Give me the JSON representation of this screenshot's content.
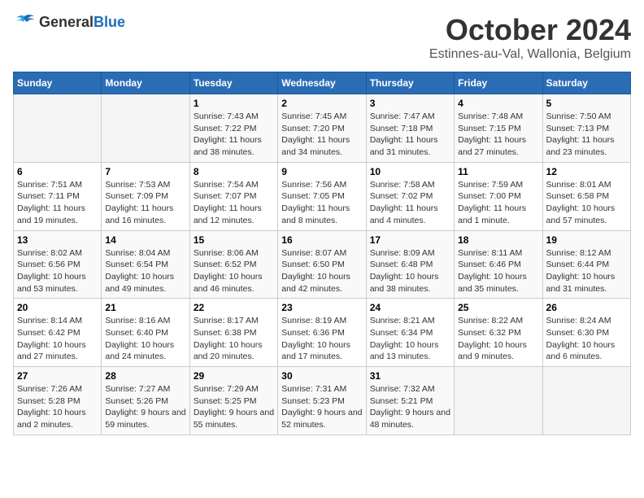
{
  "header": {
    "logo_general": "General",
    "logo_blue": "Blue",
    "month": "October 2024",
    "location": "Estinnes-au-Val, Wallonia, Belgium"
  },
  "weekdays": [
    "Sunday",
    "Monday",
    "Tuesday",
    "Wednesday",
    "Thursday",
    "Friday",
    "Saturday"
  ],
  "weeks": [
    [
      {
        "day": "",
        "sunrise": "",
        "sunset": "",
        "daylight": ""
      },
      {
        "day": "",
        "sunrise": "",
        "sunset": "",
        "daylight": ""
      },
      {
        "day": "1",
        "sunrise": "Sunrise: 7:43 AM",
        "sunset": "Sunset: 7:22 PM",
        "daylight": "Daylight: 11 hours and 38 minutes."
      },
      {
        "day": "2",
        "sunrise": "Sunrise: 7:45 AM",
        "sunset": "Sunset: 7:20 PM",
        "daylight": "Daylight: 11 hours and 34 minutes."
      },
      {
        "day": "3",
        "sunrise": "Sunrise: 7:47 AM",
        "sunset": "Sunset: 7:18 PM",
        "daylight": "Daylight: 11 hours and 31 minutes."
      },
      {
        "day": "4",
        "sunrise": "Sunrise: 7:48 AM",
        "sunset": "Sunset: 7:15 PM",
        "daylight": "Daylight: 11 hours and 27 minutes."
      },
      {
        "day": "5",
        "sunrise": "Sunrise: 7:50 AM",
        "sunset": "Sunset: 7:13 PM",
        "daylight": "Daylight: 11 hours and 23 minutes."
      }
    ],
    [
      {
        "day": "6",
        "sunrise": "Sunrise: 7:51 AM",
        "sunset": "Sunset: 7:11 PM",
        "daylight": "Daylight: 11 hours and 19 minutes."
      },
      {
        "day": "7",
        "sunrise": "Sunrise: 7:53 AM",
        "sunset": "Sunset: 7:09 PM",
        "daylight": "Daylight: 11 hours and 16 minutes."
      },
      {
        "day": "8",
        "sunrise": "Sunrise: 7:54 AM",
        "sunset": "Sunset: 7:07 PM",
        "daylight": "Daylight: 11 hours and 12 minutes."
      },
      {
        "day": "9",
        "sunrise": "Sunrise: 7:56 AM",
        "sunset": "Sunset: 7:05 PM",
        "daylight": "Daylight: 11 hours and 8 minutes."
      },
      {
        "day": "10",
        "sunrise": "Sunrise: 7:58 AM",
        "sunset": "Sunset: 7:02 PM",
        "daylight": "Daylight: 11 hours and 4 minutes."
      },
      {
        "day": "11",
        "sunrise": "Sunrise: 7:59 AM",
        "sunset": "Sunset: 7:00 PM",
        "daylight": "Daylight: 11 hours and 1 minute."
      },
      {
        "day": "12",
        "sunrise": "Sunrise: 8:01 AM",
        "sunset": "Sunset: 6:58 PM",
        "daylight": "Daylight: 10 hours and 57 minutes."
      }
    ],
    [
      {
        "day": "13",
        "sunrise": "Sunrise: 8:02 AM",
        "sunset": "Sunset: 6:56 PM",
        "daylight": "Daylight: 10 hours and 53 minutes."
      },
      {
        "day": "14",
        "sunrise": "Sunrise: 8:04 AM",
        "sunset": "Sunset: 6:54 PM",
        "daylight": "Daylight: 10 hours and 49 minutes."
      },
      {
        "day": "15",
        "sunrise": "Sunrise: 8:06 AM",
        "sunset": "Sunset: 6:52 PM",
        "daylight": "Daylight: 10 hours and 46 minutes."
      },
      {
        "day": "16",
        "sunrise": "Sunrise: 8:07 AM",
        "sunset": "Sunset: 6:50 PM",
        "daylight": "Daylight: 10 hours and 42 minutes."
      },
      {
        "day": "17",
        "sunrise": "Sunrise: 8:09 AM",
        "sunset": "Sunset: 6:48 PM",
        "daylight": "Daylight: 10 hours and 38 minutes."
      },
      {
        "day": "18",
        "sunrise": "Sunrise: 8:11 AM",
        "sunset": "Sunset: 6:46 PM",
        "daylight": "Daylight: 10 hours and 35 minutes."
      },
      {
        "day": "19",
        "sunrise": "Sunrise: 8:12 AM",
        "sunset": "Sunset: 6:44 PM",
        "daylight": "Daylight: 10 hours and 31 minutes."
      }
    ],
    [
      {
        "day": "20",
        "sunrise": "Sunrise: 8:14 AM",
        "sunset": "Sunset: 6:42 PM",
        "daylight": "Daylight: 10 hours and 27 minutes."
      },
      {
        "day": "21",
        "sunrise": "Sunrise: 8:16 AM",
        "sunset": "Sunset: 6:40 PM",
        "daylight": "Daylight: 10 hours and 24 minutes."
      },
      {
        "day": "22",
        "sunrise": "Sunrise: 8:17 AM",
        "sunset": "Sunset: 6:38 PM",
        "daylight": "Daylight: 10 hours and 20 minutes."
      },
      {
        "day": "23",
        "sunrise": "Sunrise: 8:19 AM",
        "sunset": "Sunset: 6:36 PM",
        "daylight": "Daylight: 10 hours and 17 minutes."
      },
      {
        "day": "24",
        "sunrise": "Sunrise: 8:21 AM",
        "sunset": "Sunset: 6:34 PM",
        "daylight": "Daylight: 10 hours and 13 minutes."
      },
      {
        "day": "25",
        "sunrise": "Sunrise: 8:22 AM",
        "sunset": "Sunset: 6:32 PM",
        "daylight": "Daylight: 10 hours and 9 minutes."
      },
      {
        "day": "26",
        "sunrise": "Sunrise: 8:24 AM",
        "sunset": "Sunset: 6:30 PM",
        "daylight": "Daylight: 10 hours and 6 minutes."
      }
    ],
    [
      {
        "day": "27",
        "sunrise": "Sunrise: 7:26 AM",
        "sunset": "Sunset: 5:28 PM",
        "daylight": "Daylight: 10 hours and 2 minutes."
      },
      {
        "day": "28",
        "sunrise": "Sunrise: 7:27 AM",
        "sunset": "Sunset: 5:26 PM",
        "daylight": "Daylight: 9 hours and 59 minutes."
      },
      {
        "day": "29",
        "sunrise": "Sunrise: 7:29 AM",
        "sunset": "Sunset: 5:25 PM",
        "daylight": "Daylight: 9 hours and 55 minutes."
      },
      {
        "day": "30",
        "sunrise": "Sunrise: 7:31 AM",
        "sunset": "Sunset: 5:23 PM",
        "daylight": "Daylight: 9 hours and 52 minutes."
      },
      {
        "day": "31",
        "sunrise": "Sunrise: 7:32 AM",
        "sunset": "Sunset: 5:21 PM",
        "daylight": "Daylight: 9 hours and 48 minutes."
      },
      {
        "day": "",
        "sunrise": "",
        "sunset": "",
        "daylight": ""
      },
      {
        "day": "",
        "sunrise": "",
        "sunset": "",
        "daylight": ""
      }
    ]
  ]
}
